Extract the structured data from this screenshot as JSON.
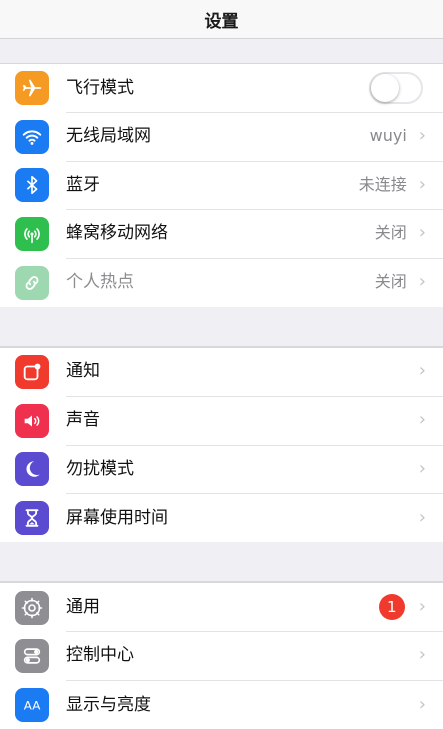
{
  "header": {
    "title": "设置"
  },
  "groups": [
    {
      "items": [
        {
          "label": "飞行模式",
          "icon": "airplane-icon",
          "color": "#f59a23",
          "toggle": false
        },
        {
          "label": "无线局域网",
          "icon": "wifi-icon",
          "color": "#1a7bf2",
          "value": "wuyi"
        },
        {
          "label": "蓝牙",
          "icon": "bluetooth-icon",
          "color": "#1a7bf2",
          "value": "未连接"
        },
        {
          "label": "蜂窝移动网络",
          "icon": "cellular-icon",
          "color": "#2fbf4e",
          "value": "关闭"
        },
        {
          "label": "个人热点",
          "icon": "hotspot-icon",
          "color": "#9ed8b0",
          "value": "关闭",
          "disabled": true
        }
      ]
    },
    {
      "items": [
        {
          "label": "通知",
          "icon": "notifications-icon",
          "color": "#f03a2e"
        },
        {
          "label": "声音",
          "icon": "sound-icon",
          "color": "#f0304f"
        },
        {
          "label": "勿扰模式",
          "icon": "moon-icon",
          "color": "#5b4bd0"
        },
        {
          "label": "屏幕使用时间",
          "icon": "hourglass-icon",
          "color": "#5b4bd0"
        }
      ]
    },
    {
      "items": [
        {
          "label": "通用",
          "icon": "gear-icon",
          "color": "#8e8e93",
          "badge": "1"
        },
        {
          "label": "控制中心",
          "icon": "control-center-icon",
          "color": "#8e8e93"
        },
        {
          "label": "显示与亮度",
          "icon": "display-icon",
          "color": "#1a7bf2"
        }
      ]
    }
  ],
  "chevron": "›"
}
